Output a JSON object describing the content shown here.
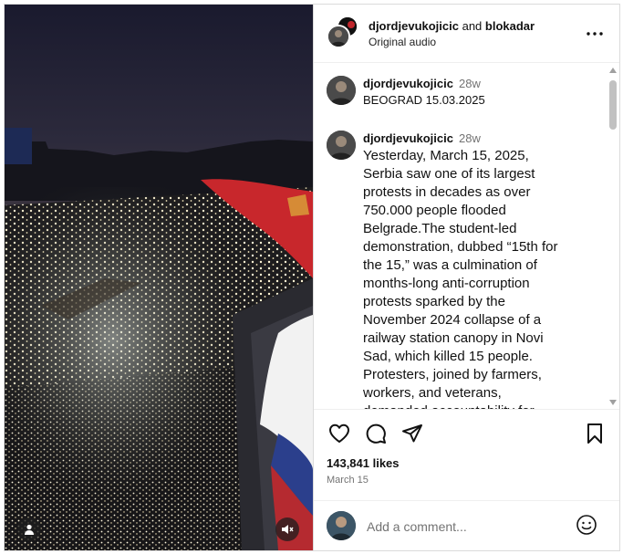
{
  "header": {
    "user1": "djordjevukojicic",
    "and": " and ",
    "user2": "blokadar",
    "audio": "Original audio",
    "more_icon": "more-horizontal-icon"
  },
  "comments": [
    {
      "user": "djordjevukojicic",
      "time": "28w",
      "text": "BEOGRAD 15.03.2025"
    },
    {
      "user": "djordjevukojicic",
      "time": "28w",
      "text": "Yesterday, March 15, 2025, Serbia saw one of its largest protests in decades as over 750.000 people flooded Belgrade.The student-led demonstration, dubbed “15th for the 15,” was a culmination of months-long anti-corruption protests sparked by the November 2024 collapse of a railway station canopy in Novi Sad, which killed 15 people. Protesters, joined by farmers, workers, and veterans, demanded accountability for"
    }
  ],
  "actions": {
    "like_icon": "heart-icon",
    "comment_icon": "comment-bubble-icon",
    "share_icon": "paper-plane-icon",
    "save_icon": "bookmark-icon"
  },
  "likes": "143,841 likes",
  "date": "March 15",
  "add_comment": {
    "placeholder": "Add a comment...",
    "emoji_icon": "emoji-icon"
  },
  "media": {
    "user_tag_icon": "user-tag-icon",
    "mute_icon": "speaker-muted-icon"
  },
  "colors": {
    "text": "#111111",
    "secondary": "#737373",
    "border": "#dbdbdb"
  }
}
